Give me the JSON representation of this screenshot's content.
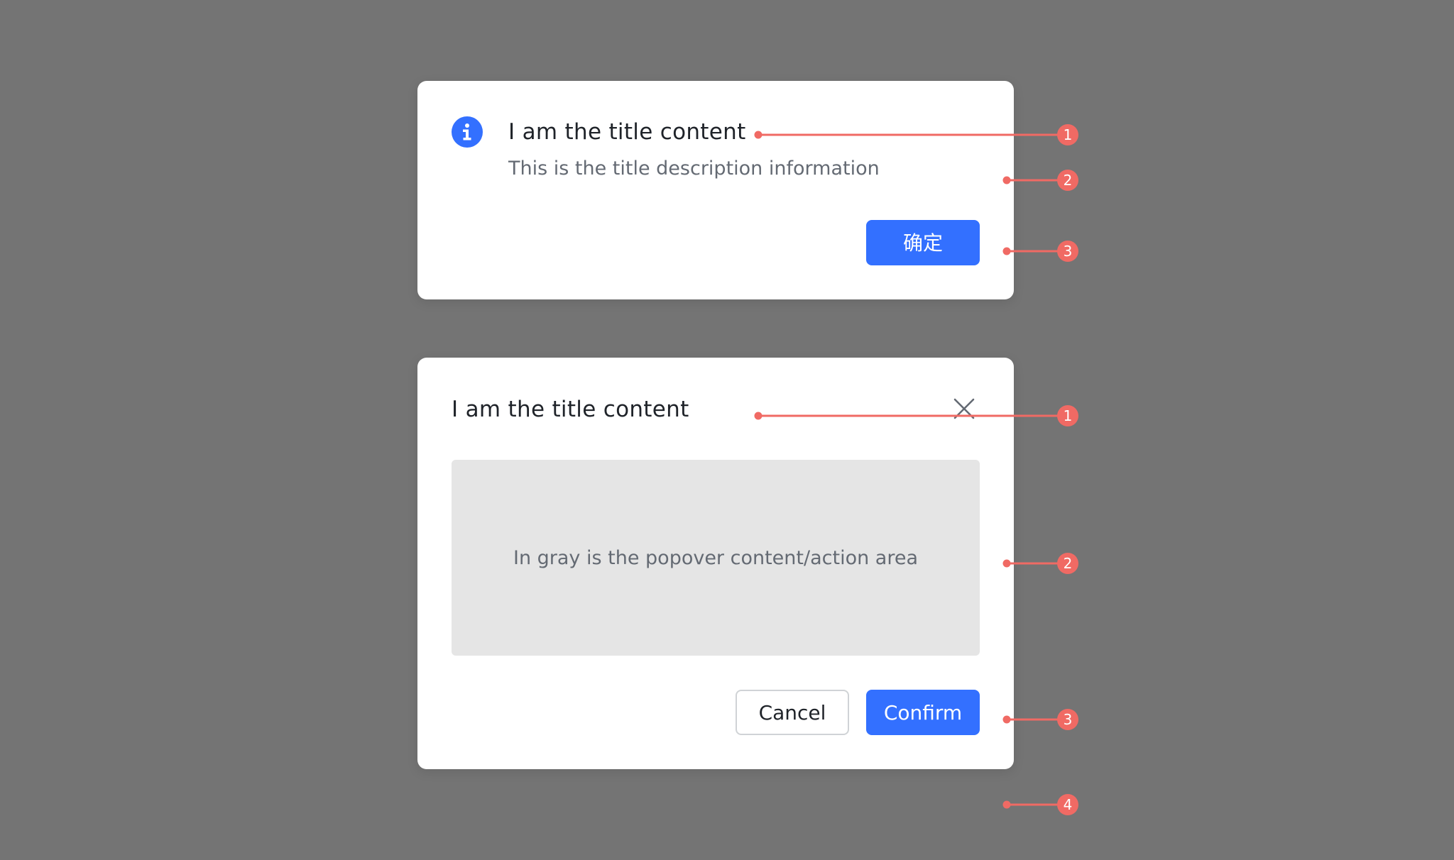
{
  "card_info": {
    "title": "I am the title content",
    "description": "This is the title description information",
    "confirm_label": "确定",
    "icon": "info-icon"
  },
  "card_dialog": {
    "title": "I am the title content",
    "content_text": "In gray is the popover content/action area",
    "cancel_label": "Cancel",
    "confirm_label": "Confirm",
    "close_icon": "close-icon"
  },
  "markers": [
    "1",
    "2",
    "3",
    "1",
    "2",
    "3",
    "4"
  ],
  "colors": {
    "background": "#747474",
    "card": "#ffffff",
    "primary": "#3370ff",
    "annotation": "#f06a64",
    "content_area": "#e5e5e5"
  }
}
